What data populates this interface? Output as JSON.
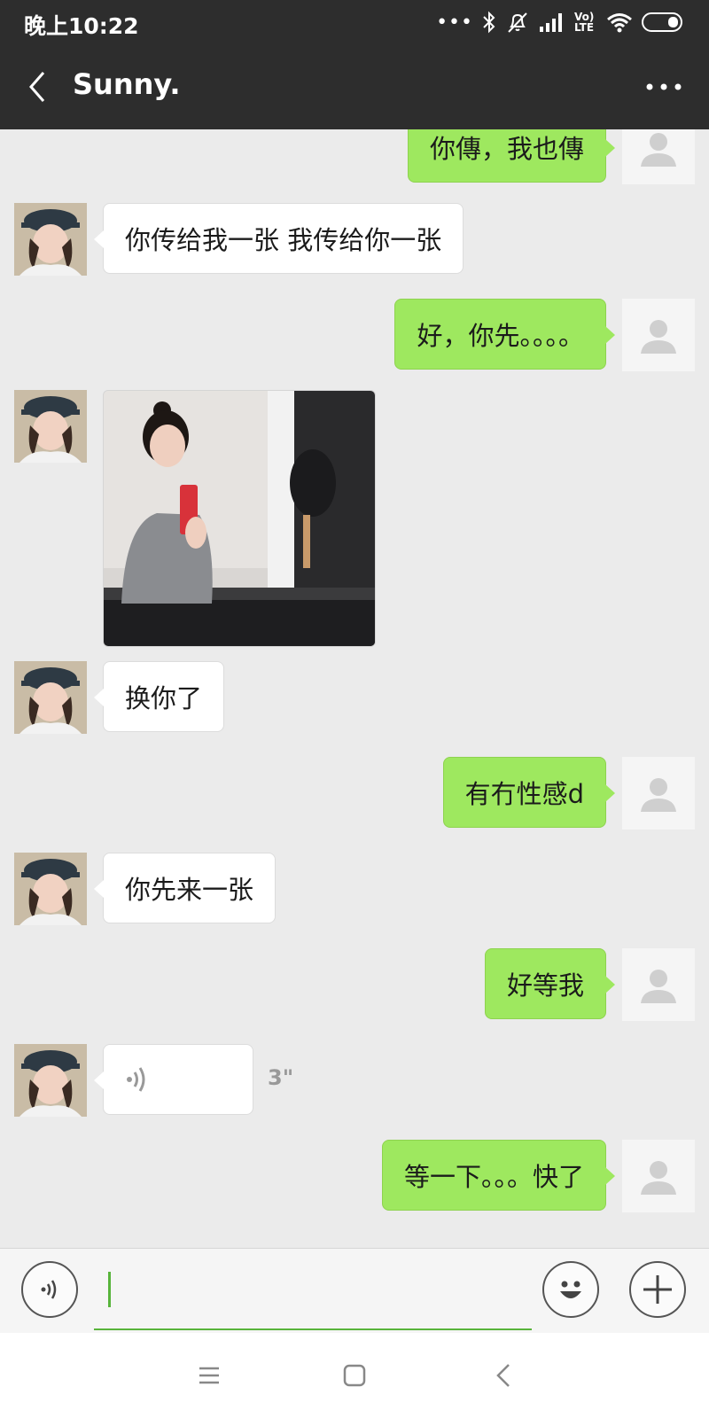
{
  "status": {
    "time": "晚上10:22",
    "dots": "•••",
    "network_label": "Vo) LTE"
  },
  "header": {
    "title": "Sunny."
  },
  "messages": [
    {
      "side": "out",
      "type": "text",
      "text": "你傳，我也傳"
    },
    {
      "side": "in",
      "type": "text",
      "text": "你传给我一张 我传给你一张"
    },
    {
      "side": "out",
      "type": "text",
      "text": "好，你先。。。。"
    },
    {
      "side": "in",
      "type": "image"
    },
    {
      "side": "in",
      "type": "text",
      "text": "换你了"
    },
    {
      "side": "out",
      "type": "text",
      "text": "有冇性感d"
    },
    {
      "side": "in",
      "type": "text",
      "text": "你先来一张"
    },
    {
      "side": "out",
      "type": "text",
      "text": "好等我"
    },
    {
      "side": "in",
      "type": "voice",
      "duration": "3\""
    },
    {
      "side": "out",
      "type": "text",
      "text": "等一下。。。快了"
    }
  ],
  "input": {
    "value": "",
    "placeholder": ""
  },
  "colors": {
    "bar": "#2d2d2d",
    "chat_bg": "#ebebeb",
    "outgoing_bubble": "#9ee85f",
    "incoming_bubble": "#ffffff",
    "accent": "#58b43b"
  },
  "icons": {
    "back": "chevron-left-icon",
    "more": "more-dots-icon",
    "voice_toggle": "voice-icon",
    "emoji": "emoji-icon",
    "add": "plus-icon",
    "nav_menu": "menu-icon",
    "nav_home": "home-square-icon",
    "nav_back": "nav-back-icon"
  }
}
